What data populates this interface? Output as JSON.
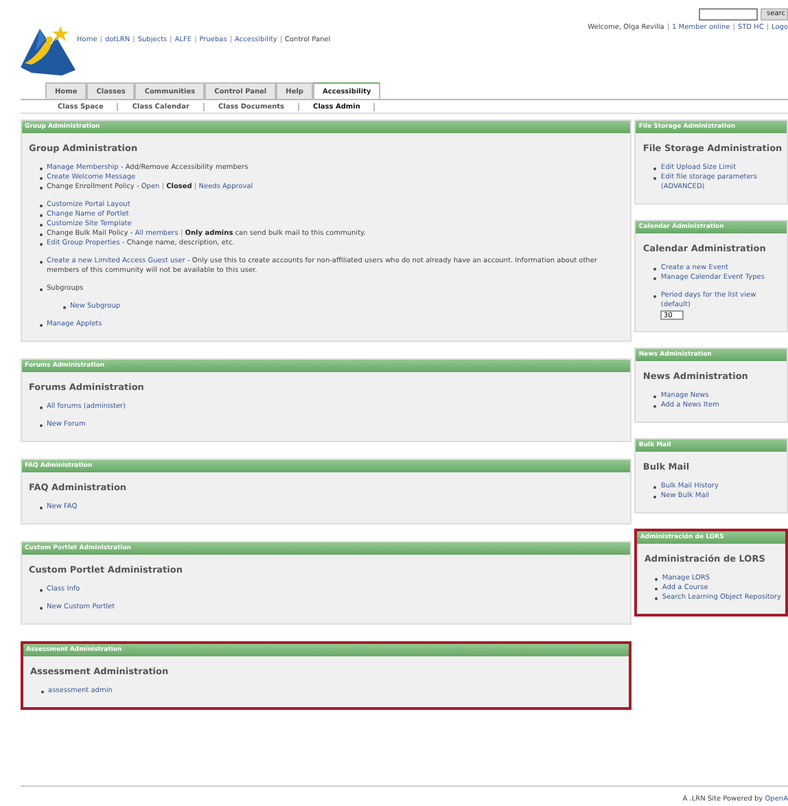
{
  "search": {
    "button": "searc"
  },
  "user_bar": [
    {
      "text": "Welcome, Olga Revilla",
      "kind": "text"
    },
    {
      "text": "|",
      "kind": "sep"
    },
    {
      "text": "1 Member online",
      "kind": "link"
    },
    {
      "text": "|",
      "kind": "sep"
    },
    {
      "text": "STD HC",
      "kind": "link"
    },
    {
      "text": "|",
      "kind": "sep"
    },
    {
      "text": "Logo",
      "kind": "link"
    }
  ],
  "breadcrumb": [
    {
      "text": "Home",
      "kind": "link"
    },
    {
      "text": "|",
      "kind": "sep"
    },
    {
      "text": "dotLRN",
      "kind": "link"
    },
    {
      "text": "|",
      "kind": "sep"
    },
    {
      "text": "Subjects",
      "kind": "link"
    },
    {
      "text": "|",
      "kind": "sep"
    },
    {
      "text": "ALFE",
      "kind": "link"
    },
    {
      "text": "|",
      "kind": "sep"
    },
    {
      "text": "Pruebas",
      "kind": "link"
    },
    {
      "text": "|",
      "kind": "sep"
    },
    {
      "text": "Accessibility",
      "kind": "link"
    },
    {
      "text": "|",
      "kind": "sep"
    },
    {
      "text": "Control Panel",
      "kind": "text"
    }
  ],
  "tabs": [
    {
      "label": "Home",
      "selected": false
    },
    {
      "label": "Classes",
      "selected": false
    },
    {
      "label": "Communities",
      "selected": false
    },
    {
      "label": "Control Panel",
      "selected": false
    },
    {
      "label": "Help",
      "selected": false
    },
    {
      "label": "Accessibility",
      "selected": true
    }
  ],
  "subtabs": [
    {
      "label": "Class Space",
      "selected": false
    },
    {
      "label": "Class Calendar",
      "selected": false
    },
    {
      "label": "Class Documents",
      "selected": false
    },
    {
      "label": "Class Admin",
      "selected": true
    }
  ],
  "columns": [
    {
      "portlets": [
        {
          "title": "Group Administration",
          "heading": "Group Administration",
          "highlighted": false,
          "groups": [
            [
              {
                "parts": [
                  {
                    "text": "Manage Membership",
                    "kind": "link"
                  },
                  {
                    "text": " - Add/Remove Accessibility members",
                    "kind": "text"
                  }
                ]
              },
              {
                "parts": [
                  {
                    "text": "Create Welcome Message",
                    "kind": "link"
                  }
                ]
              },
              {
                "parts": [
                  {
                    "text": "Change Enrollment Policy - ",
                    "kind": "text"
                  },
                  {
                    "text": "Open",
                    "kind": "link"
                  },
                  {
                    "text": " | ",
                    "kind": "sep"
                  },
                  {
                    "text": "Closed",
                    "kind": "bold"
                  },
                  {
                    "text": " | ",
                    "kind": "sep"
                  },
                  {
                    "text": "Needs Approval",
                    "kind": "link"
                  }
                ]
              }
            ],
            [
              {
                "parts": [
                  {
                    "text": "Customize Portal Layout",
                    "kind": "link"
                  }
                ]
              },
              {
                "parts": [
                  {
                    "text": "Change Name of Portlet",
                    "kind": "link"
                  }
                ]
              },
              {
                "parts": [
                  {
                    "text": "Customize Site Template",
                    "kind": "link"
                  }
                ]
              },
              {
                "parts": [
                  {
                    "text": "Change Bulk Mail Policy - ",
                    "kind": "text"
                  },
                  {
                    "text": "All members",
                    "kind": "link"
                  },
                  {
                    "text": " | ",
                    "kind": "sep"
                  },
                  {
                    "text": "Only admins",
                    "kind": "bold"
                  },
                  {
                    "text": " can send bulk mail to this community.",
                    "kind": "text"
                  }
                ]
              },
              {
                "parts": [
                  {
                    "text": "Edit Group Properties",
                    "kind": "link"
                  },
                  {
                    "text": " - Change name, description, etc.",
                    "kind": "text"
                  }
                ]
              }
            ],
            [
              {
                "parts": [
                  {
                    "text": "Create a new Limited Access Guest user",
                    "kind": "link"
                  },
                  {
                    "text": " - Only use this to create accounts for non-affiliated users who do not already have an account. Information about other members of this community will not be available to this user.",
                    "kind": "text"
                  }
                ]
              }
            ],
            [
              {
                "parts": [
                  {
                    "text": "Subgroups",
                    "kind": "text"
                  }
                ],
                "children": [
                  {
                    "parts": [
                      {
                        "text": "New Subgroup",
                        "kind": "link"
                      }
                    ]
                  }
                ]
              }
            ],
            [
              {
                "parts": [
                  {
                    "text": "Manage Applets",
                    "kind": "link"
                  }
                ]
              }
            ]
          ]
        },
        {
          "title": "Forums Administration",
          "heading": "Forums Administration",
          "highlighted": false,
          "groups": [
            [
              {
                "parts": [
                  {
                    "text": "All forums (administer)",
                    "kind": "link"
                  }
                ]
              }
            ],
            [
              {
                "parts": [
                  {
                    "text": "New Forum",
                    "kind": "link"
                  }
                ]
              }
            ]
          ]
        },
        {
          "title": "FAQ Administration",
          "heading": "FAQ Administration",
          "highlighted": false,
          "groups": [
            [
              {
                "parts": [
                  {
                    "text": "New FAQ",
                    "kind": "link"
                  }
                ]
              }
            ]
          ]
        },
        {
          "title": "Custom Portlet Administration",
          "heading": "Custom Portlet Administration",
          "highlighted": false,
          "groups": [
            [
              {
                "parts": [
                  {
                    "text": "Class Info",
                    "kind": "link"
                  }
                ]
              }
            ],
            [
              {
                "parts": [
                  {
                    "text": "New Custom Portlet",
                    "kind": "link"
                  }
                ]
              }
            ]
          ]
        },
        {
          "title": "Assessment Administration",
          "heading": "Assessment Administration",
          "highlighted": true,
          "groups": [
            [
              {
                "parts": [
                  {
                    "text": "assessment admin",
                    "kind": "link"
                  }
                ]
              }
            ]
          ]
        }
      ]
    },
    {
      "portlets": [
        {
          "title": "File Storage Administration",
          "heading": "File Storage Administration",
          "highlighted": false,
          "groups": [
            [
              {
                "parts": [
                  {
                    "text": "Edit Upload Size Limit",
                    "kind": "link"
                  }
                ]
              },
              {
                "parts": [
                  {
                    "text": "Edit file storage parameters (ADVANCED)",
                    "kind": "link"
                  }
                ]
              }
            ]
          ]
        },
        {
          "title": "Calendar Administration",
          "heading": "Calendar Administration",
          "highlighted": false,
          "groups": [
            [
              {
                "parts": [
                  {
                    "text": "Create a new Event",
                    "kind": "link"
                  }
                ]
              },
              {
                "parts": [
                  {
                    "text": "Manage Calendar Event Types",
                    "kind": "link"
                  }
                ]
              }
            ],
            [
              {
                "parts": [
                  {
                    "text": "Period days for the list view (default)",
                    "kind": "link"
                  }
                ],
                "field": "30"
              }
            ]
          ]
        },
        {
          "title": "News Administration",
          "heading": "News Administration",
          "highlighted": false,
          "groups": [
            [
              {
                "parts": [
                  {
                    "text": "Manage News",
                    "kind": "link"
                  }
                ]
              },
              {
                "parts": [
                  {
                    "text": "Add a News Item",
                    "kind": "link"
                  }
                ]
              }
            ]
          ]
        },
        {
          "title": "Bulk Mail",
          "heading": "Bulk Mail",
          "highlighted": false,
          "groups": [
            [
              {
                "parts": [
                  {
                    "text": "Bulk Mail History",
                    "kind": "link"
                  }
                ]
              },
              {
                "parts": [
                  {
                    "text": "New Bulk Mail",
                    "kind": "link"
                  }
                ]
              }
            ]
          ]
        },
        {
          "title": "Administración de LORS",
          "heading": "Administración de LORS",
          "highlighted": true,
          "groups": [
            [
              {
                "parts": [
                  {
                    "text": "Manage LORS",
                    "kind": "link"
                  }
                ]
              },
              {
                "parts": [
                  {
                    "text": "Add a Course",
                    "kind": "link"
                  }
                ]
              },
              {
                "parts": [
                  {
                    "text": "Search Learning Object Repository",
                    "kind": "link"
                  }
                ]
              }
            ]
          ]
        }
      ]
    }
  ],
  "footer": [
    {
      "text": "A .LRN Site Powered by ",
      "kind": "text"
    },
    {
      "text": "OpenA",
      "kind": "link"
    }
  ]
}
